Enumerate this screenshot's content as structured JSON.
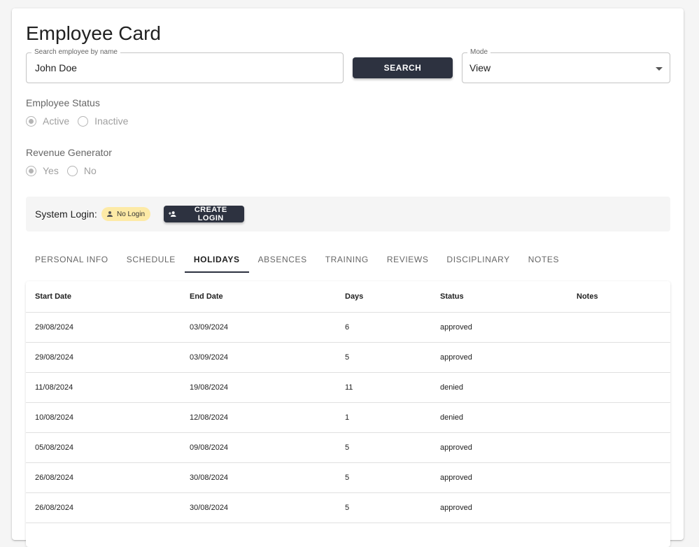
{
  "page": {
    "title": "Employee Card"
  },
  "search": {
    "label": "Search employee by name",
    "value": "John Doe",
    "button": "SEARCH"
  },
  "mode": {
    "label": "Mode",
    "value": "View"
  },
  "status": {
    "label": "Employee Status",
    "options": [
      "Active",
      "Inactive"
    ],
    "selected": "Active"
  },
  "revenue": {
    "label": "Revenue Generator",
    "options": [
      "Yes",
      "No"
    ],
    "selected": "Yes"
  },
  "login": {
    "label": "System Login:",
    "chip": "No Login",
    "button": "CREATE LOGIN",
    "chip_color": "#fdeaa6"
  },
  "tabs": [
    "PERSONAL INFO",
    "SCHEDULE",
    "HOLIDAYS",
    "ABSENCES",
    "TRAINING",
    "REVIEWS",
    "DISCIPLINARY",
    "NOTES"
  ],
  "active_tab": "HOLIDAYS",
  "table": {
    "headers": [
      "Start Date",
      "End Date",
      "Days",
      "Status",
      "Notes"
    ],
    "rows": [
      [
        "29/08/2024",
        "03/09/2024",
        "6",
        "approved",
        ""
      ],
      [
        "29/08/2024",
        "03/09/2024",
        "5",
        "approved",
        ""
      ],
      [
        "11/08/2024",
        "19/08/2024",
        "11",
        "denied",
        ""
      ],
      [
        "10/08/2024",
        "12/08/2024",
        "1",
        "denied",
        ""
      ],
      [
        "05/08/2024",
        "09/08/2024",
        "5",
        "approved",
        ""
      ],
      [
        "26/08/2024",
        "30/08/2024",
        "5",
        "approved",
        ""
      ],
      [
        "26/08/2024",
        "30/08/2024",
        "5",
        "approved",
        ""
      ]
    ]
  },
  "colors": {
    "primary": "#2d3240",
    "background": "#f5f5f5"
  }
}
